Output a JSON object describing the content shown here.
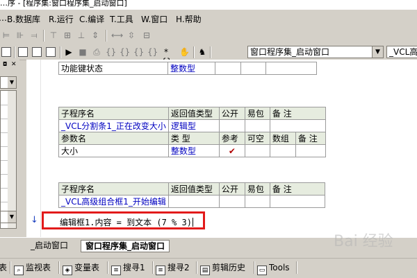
{
  "titlebar": {
    "text": "…序 - [程序集:窗口程序集_启动窗口]"
  },
  "menu": [
    {
      "label": "…"
    },
    {
      "label": "B.数据库"
    },
    {
      "label": "R.运行"
    },
    {
      "label": "C.编译"
    },
    {
      "label": "T.工具"
    },
    {
      "label": "W.窗口"
    },
    {
      "label": "H.帮助"
    }
  ],
  "toolbar": {
    "proc_combo": "窗口程序集_启动窗口",
    "sub_combo": "_VCL高级组"
  },
  "tables": {
    "prev": {
      "name": "功能键状态",
      "type": "整数型"
    },
    "sub1": {
      "headers": [
        "子程序名",
        "返回值类型",
        "公开",
        "易包",
        "备 注"
      ],
      "name": "_VCL分割条1_正在改变大小",
      "return_type": "逻辑型",
      "param_headers": [
        "参数名",
        "类 型",
        "参考",
        "可空",
        "数组",
        "备 注"
      ],
      "param_name": "大小",
      "param_type": "整数型",
      "param_ref": "✔"
    },
    "sub2": {
      "headers": [
        "子程序名",
        "返回值类型",
        "公开",
        "易包",
        "备 注"
      ],
      "name": "_VCL高级组合框1_开始编辑"
    }
  },
  "code": {
    "line": "编辑框1.内容 = 到文本 (7 % 3)"
  },
  "tabs": [
    {
      "label": "_启动窗口"
    },
    {
      "label": "窗口程序集_启动窗口"
    }
  ],
  "bottom": [
    {
      "label": "表"
    },
    {
      "label": "监视表"
    },
    {
      "label": "变量表"
    },
    {
      "label": "搜寻1"
    },
    {
      "label": "搜寻2"
    },
    {
      "label": "剪辑历史"
    },
    {
      "label": "Tools"
    }
  ],
  "watermark": "Bai 经验"
}
